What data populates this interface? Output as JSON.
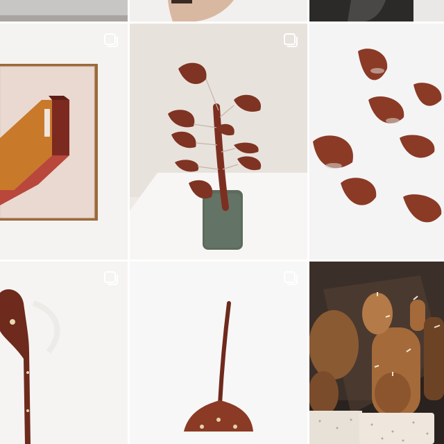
{
  "feed": {
    "grid": {
      "tiles": [
        {
          "name": "post-top-left-partial",
          "subject": "wooden-object-partial",
          "multiple": false
        },
        {
          "name": "post-top-middle-partial",
          "subject": "hand-partial",
          "multiple": false
        },
        {
          "name": "post-top-right-partial",
          "subject": "person-in-black-partial",
          "multiple": false
        },
        {
          "name": "post-framed-relief-art",
          "subject": "framed-wood-inlay-artwork",
          "multiple": true
        },
        {
          "name": "post-wooden-leaf-plant",
          "subject": "wooden-ginkgo-leaves-in-green-pot",
          "multiple": true
        },
        {
          "name": "post-wall-leaves",
          "subject": "wooden-ginkgo-leaves-on-wall",
          "multiple": false
        },
        {
          "name": "post-wall-leaf-hook-side",
          "subject": "wooden-leaf-hook-side-view",
          "multiple": true
        },
        {
          "name": "post-wall-leaf-hook-front",
          "subject": "wooden-leaf-hook-front-view",
          "multiple": true
        },
        {
          "name": "post-wooden-cacti",
          "subject": "wooden-cactus-sculptures-in-pots",
          "multiple": false
        }
      ]
    },
    "icons": {
      "multiple_posts": "multiple-posts-icon"
    },
    "colors": {
      "background": "#ffffff",
      "wood_dark": "#6e2a1c",
      "wood_mid": "#8a3a27",
      "wood_light": "#b07a4a",
      "pot_green": "#5c6b5c"
    }
  }
}
